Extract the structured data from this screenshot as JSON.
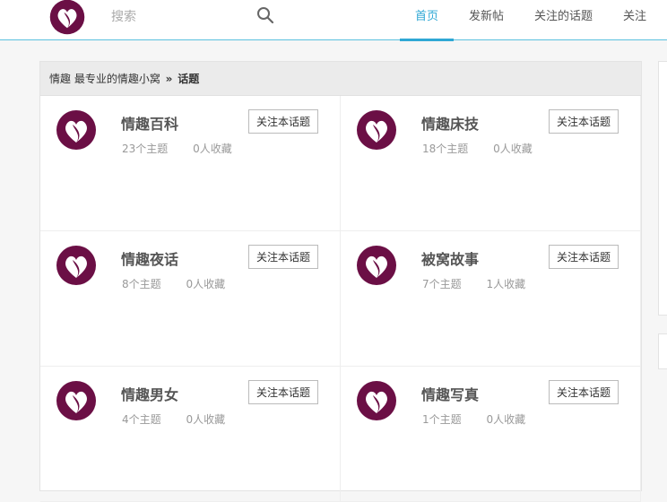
{
  "header": {
    "search_placeholder": "搜索",
    "nav": [
      "首页",
      "发新帖",
      "关注的话题",
      "关注"
    ]
  },
  "breadcrumb": {
    "site": "情趣 最专业的情趣小窝",
    "separator": "»",
    "current": "话题"
  },
  "topics": [
    {
      "name": "情趣百科",
      "topics_count": "23个主题",
      "favorites": "0人收藏",
      "follow_label": "关注本话题"
    },
    {
      "name": "情趣床技",
      "topics_count": "18个主题",
      "favorites": "0人收藏",
      "follow_label": "关注本话题"
    },
    {
      "name": "情趣夜话",
      "topics_count": "8个主题",
      "favorites": "0人收藏",
      "follow_label": "关注本话题"
    },
    {
      "name": "被窝故事",
      "topics_count": "7个主题",
      "favorites": "1人收藏",
      "follow_label": "关注本话题"
    },
    {
      "name": "情趣男女",
      "topics_count": "4个主题",
      "favorites": "0人收藏",
      "follow_label": "关注本话题"
    },
    {
      "name": "情趣写真",
      "topics_count": "1个主题",
      "favorites": "0人收藏",
      "follow_label": "关注本话题"
    }
  ],
  "colors": {
    "accent": "#2fa8d5",
    "brand": "#6b0f45"
  },
  "icons": {
    "logo": "heart-logo-icon",
    "search": "search-icon"
  }
}
